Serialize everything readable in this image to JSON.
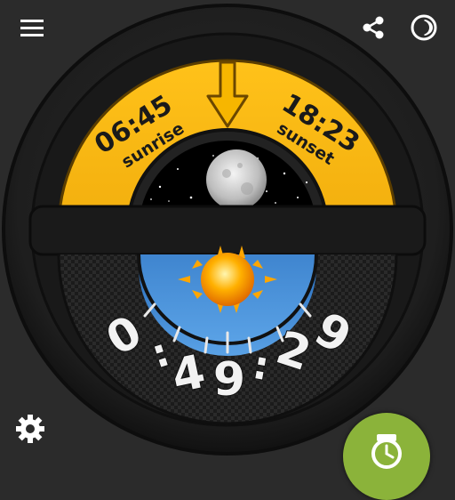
{
  "colors": {
    "background": "#2b2b2b",
    "accent_yellow": "#f6b200",
    "fab_green": "#8bb33a",
    "sky_blue": "#2e78c8"
  },
  "toolbar": {
    "menu_icon": "hamburger-menu-icon",
    "share_icon": "share-icon",
    "theme_icon": "half-moon-theme-icon"
  },
  "watchface": {
    "sunrise": {
      "time": "06:45",
      "label": "sunrise"
    },
    "sunset": {
      "time": "18:23",
      "label": "sunset"
    },
    "moon_icon": "full-moon-icon",
    "sun_icon": "sun-icon",
    "pointer_icon": "down-arrow-pointer-icon",
    "clock_digits": [
      "0",
      ":",
      "4",
      "9",
      ":",
      "2",
      "9"
    ]
  },
  "bottom": {
    "settings_icon": "gear-icon",
    "fab_icon": "watch-sync-icon"
  }
}
